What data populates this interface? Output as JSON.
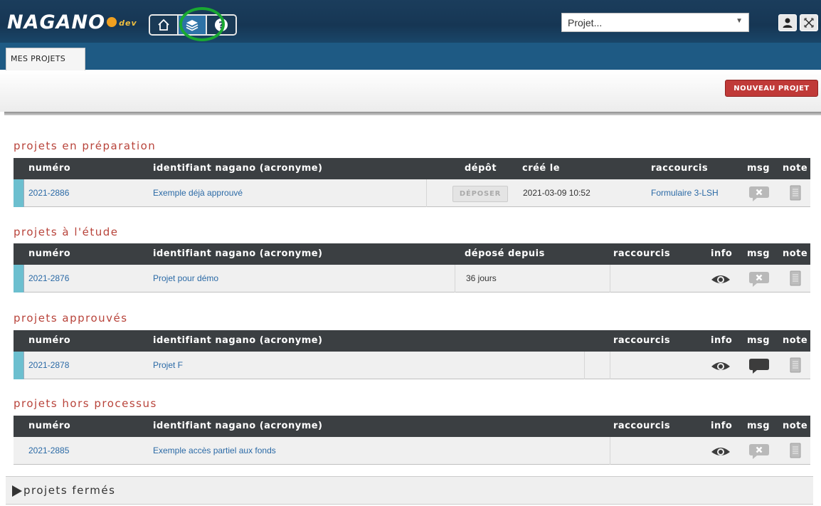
{
  "header": {
    "logo_text": "NAGANO",
    "logo_suffix": "dev",
    "project_select": {
      "value": "Projet...",
      "placeholder": "Projet..."
    },
    "nav_icons": [
      "home-icon",
      "layers-icon",
      "help-icon"
    ],
    "user_icons": [
      "user-icon",
      "close-icon"
    ]
  },
  "tabs": [
    {
      "label": "MES PROJETS"
    }
  ],
  "toolbar": {
    "new_project_label": "NOUVEAU PROJET"
  },
  "sections": {
    "preparation": {
      "title": "projets en préparation",
      "headers": [
        "numéro",
        "identifiant nagano (acronyme)",
        "dépôt",
        "créé le",
        "raccourcis",
        "msg",
        "note"
      ],
      "rows": [
        {
          "numero": "2021-2886",
          "identifiant": "Exemple déjà approuvé",
          "depot_button": "DÉPOSER",
          "cree_le": "2021-03-09 10:52",
          "raccourci": "Formulaire 3-LSH",
          "msg": "no-message-icon",
          "note": "note-icon"
        }
      ]
    },
    "etude": {
      "title": "projets à l'étude",
      "headers": [
        "numéro",
        "identifiant nagano (acronyme)",
        "déposé depuis",
        "raccourcis",
        "info",
        "msg",
        "note"
      ],
      "rows": [
        {
          "numero": "2021-2876",
          "identifiant": "Projet pour démo",
          "depose_depuis": "36 jours",
          "info": "eye-icon",
          "msg": "no-message-icon",
          "note": "note-icon"
        }
      ]
    },
    "approuves": {
      "title": "projets approuvés",
      "headers": [
        "numéro",
        "identifiant nagano (acronyme)",
        "raccourcis",
        "info",
        "msg",
        "note"
      ],
      "rows": [
        {
          "numero": "2021-2878",
          "identifiant": "Projet F",
          "info": "eye-icon",
          "msg": "message-icon",
          "note": "note-icon"
        }
      ]
    },
    "hors_processus": {
      "title": "projets hors processus",
      "headers": [
        "numéro",
        "identifiant nagano (acronyme)",
        "raccourcis",
        "info",
        "msg",
        "note"
      ],
      "rows": [
        {
          "numero": "2021-2885",
          "identifiant": "Exemple accès partiel aux fonds",
          "info": "eye-icon",
          "msg": "no-message-icon",
          "note": "note-icon"
        }
      ]
    },
    "fermes": {
      "title": "projets fermés",
      "collapsed": true
    }
  },
  "colors": {
    "header_bg": "#163654",
    "section_title": "#b8433a",
    "table_header": "#3b3f42",
    "accent_bar": "#6cbfcf",
    "link": "#2b6aa6",
    "new_button": "#c03a38",
    "focus_ring": "#19a832"
  }
}
